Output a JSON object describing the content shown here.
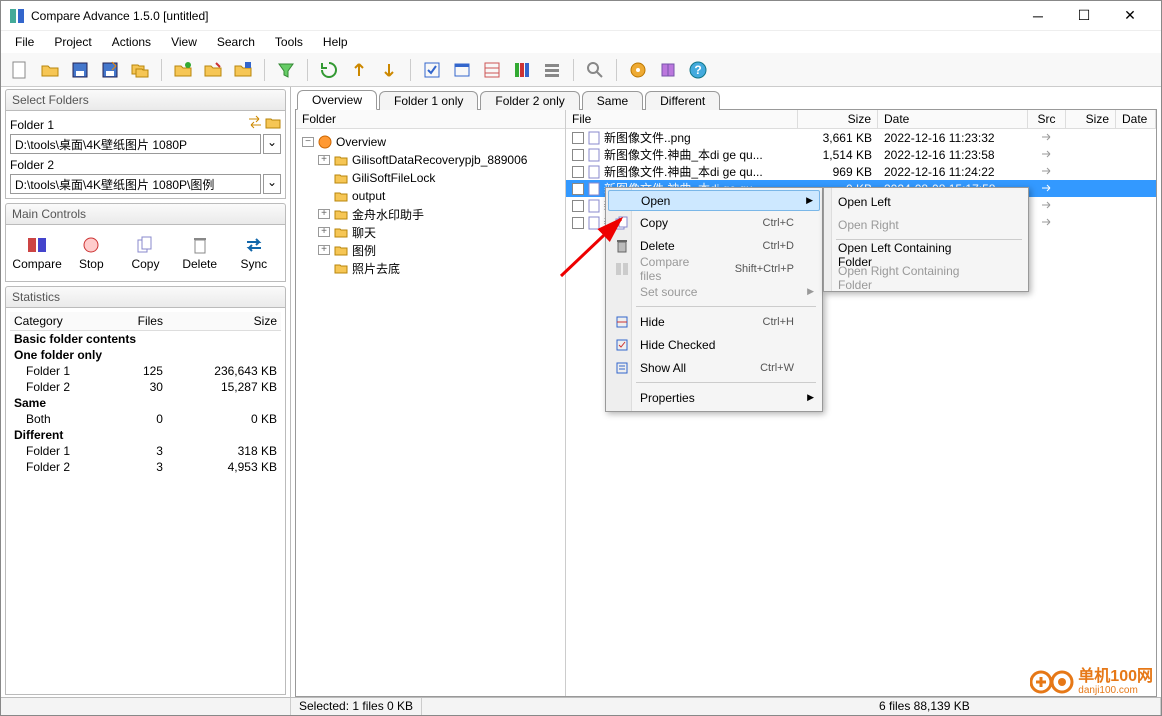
{
  "window": {
    "title": "Compare Advance 1.5.0 [untitled]"
  },
  "menu": [
    "File",
    "Project",
    "Actions",
    "View",
    "Search",
    "Tools",
    "Help"
  ],
  "select_folders": {
    "header": "Select Folders",
    "f1_label": "Folder 1",
    "f1_value": "D:\\tools\\桌面\\4K壁纸图片 1080P",
    "f2_label": "Folder 2",
    "f2_value": "D:\\tools\\桌面\\4K壁纸图片 1080P\\图例"
  },
  "main_controls": {
    "header": "Main Controls",
    "compare": "Compare",
    "stop": "Stop",
    "copy": "Copy",
    "delete": "Delete",
    "sync": "Sync"
  },
  "statistics": {
    "header": "Statistics",
    "cols": [
      "Category",
      "Files",
      "Size"
    ],
    "basic": "Basic folder contents",
    "onefolder": "One folder only",
    "f1_only": {
      "label": "Folder 1",
      "files": "125",
      "size": "236,643 KB"
    },
    "f2_only": {
      "label": "Folder 2",
      "files": "30",
      "size": "15,287 KB"
    },
    "same": "Same",
    "both": {
      "label": "Both",
      "files": "0",
      "size": "0 KB"
    },
    "different": "Different",
    "f1_diff": {
      "label": "Folder 1",
      "files": "3",
      "size": "318 KB"
    },
    "f2_diff": {
      "label": "Folder 2",
      "files": "3",
      "size": "4,953 KB"
    }
  },
  "tabs": [
    "Overview",
    "Folder 1 only",
    "Folder 2 only",
    "Same",
    "Different"
  ],
  "tree": {
    "header": "Folder",
    "root": "Overview",
    "children": [
      "GilisoftDataRecoverypjb_889006",
      "GiliSoftFileLock",
      "output",
      "金舟水印助手",
      "聊天",
      "图例",
      "照片去底"
    ]
  },
  "filelist": {
    "cols": {
      "file": "File",
      "size": "Size",
      "date": "Date",
      "src": "Src",
      "size2": "Size",
      "date2": "Date"
    },
    "rows": [
      {
        "name": "新图像文件..png",
        "size": "3,661 KB",
        "date": "2022-12-16 11:23:32"
      },
      {
        "name": "新图像文件.神曲_本di ge qu...",
        "size": "1,514 KB",
        "date": "2022-12-16 11:23:58"
      },
      {
        "name": "新图像文件.神曲_本di ge qu...",
        "size": "969 KB",
        "date": "2022-12-16 11:24:22"
      },
      {
        "name": "新图像文件.神曲_本di ge qu...",
        "size": "0 KB",
        "date": "2024-08-08 15:17:58",
        "selected": true
      },
      {
        "name": "新",
        "size": "",
        "date": ""
      },
      {
        "name": "新图",
        "size": "",
        "date": ""
      }
    ]
  },
  "context_menu": {
    "open": "Open",
    "copy": {
      "label": "Copy",
      "short": "Ctrl+C"
    },
    "delete": {
      "label": "Delete",
      "short": "Ctrl+D"
    },
    "compare_files": {
      "label": "Compare files",
      "short": "Shift+Ctrl+P"
    },
    "set_source": "Set source",
    "hide": {
      "label": "Hide",
      "short": "Ctrl+H"
    },
    "hide_checked": "Hide Checked",
    "show_all": {
      "label": "Show All",
      "short": "Ctrl+W"
    },
    "properties": "Properties"
  },
  "sub_menu": {
    "open_left": "Open Left",
    "open_right": "Open Right",
    "open_left_folder": "Open Left Containing Folder",
    "open_right_folder": "Open Right Containing Folder"
  },
  "statusbar": {
    "selected": "Selected: 1 files 0 KB",
    "total": "6 files 88,139 KB"
  },
  "watermark": {
    "line1": "单机100网",
    "line2": "danji100.com"
  }
}
